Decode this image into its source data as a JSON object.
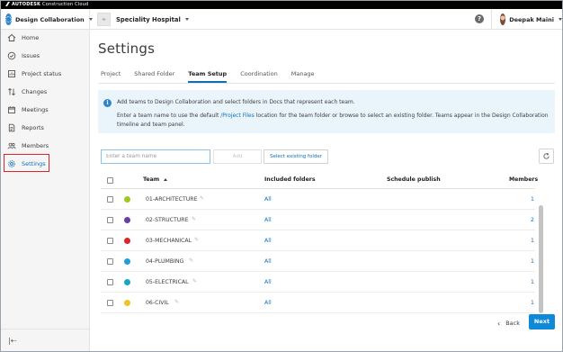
{
  "brand": {
    "logo_text": "AUTODESK",
    "product_text": "Construction Cloud"
  },
  "header": {
    "module_name": "Design Collaboration",
    "project_name": "Speciality Hospital",
    "help_label": "?",
    "user_name": "Deepak Maini"
  },
  "sidebar": {
    "items": [
      {
        "label": "Home",
        "icon": "home-icon"
      },
      {
        "label": "Issues",
        "icon": "issues-icon"
      },
      {
        "label": "Project status",
        "icon": "project-status-icon"
      },
      {
        "label": "Changes",
        "icon": "changes-icon"
      },
      {
        "label": "Meetings",
        "icon": "meetings-icon"
      },
      {
        "label": "Reports",
        "icon": "reports-icon"
      },
      {
        "label": "Members",
        "icon": "members-icon"
      },
      {
        "label": "Settings",
        "icon": "gear-icon"
      }
    ],
    "active": "Settings",
    "collapse_icon": "collapse-sidebar-icon"
  },
  "main": {
    "title": "Settings",
    "tabs": [
      {
        "label": "Project"
      },
      {
        "label": "Shared Folder"
      },
      {
        "label": "Team Setup"
      },
      {
        "label": "Coordination"
      },
      {
        "label": "Manage"
      }
    ],
    "active_tab": "Team Setup",
    "info": {
      "line1": "Add teams to Design Collaboration and select folders in Docs that represent each team.",
      "line2_before": "Enter a team name to use the default ",
      "line2_link": "/Project Files",
      "line2_after": " location for the team folder or browse to select an existing folder. Teams appear in the Design Collaboration",
      "line3": "timeline and team panel."
    },
    "team_input_placeholder": "Enter a team name",
    "add_label": "Add",
    "select_folder_label": "Select existing folder",
    "table": {
      "headers": {
        "team": "Team",
        "folders": "Included folders",
        "schedule": "Schedule publish",
        "members": "Members"
      },
      "rows": [
        {
          "name": "01-ARCHITECTURE",
          "color": "#a0c81e",
          "folders": "All",
          "members": "1"
        },
        {
          "name": "02-STRUCTURE",
          "color": "#6a3ea8",
          "folders": "All",
          "members": "2"
        },
        {
          "name": "03-MECHANICAL",
          "color": "#d9272e",
          "folders": "All",
          "members": "1"
        },
        {
          "name": "04-PLUMBING",
          "color": "#1e9fd9",
          "folders": "All",
          "members": "1"
        },
        {
          "name": "05-ELECTRICAL",
          "color": "#16a6c4",
          "folders": "All",
          "members": "1"
        },
        {
          "name": "06-CIVIL",
          "color": "#f0c324",
          "folders": "All",
          "members": "1"
        }
      ]
    },
    "back_label": "Back",
    "next_label": "Next"
  },
  "colors": {
    "accent": "#0f70b7",
    "primary_button": "#0f8ad6",
    "highlight_box": "#e0242c",
    "info_bg": "#eaf4fb"
  }
}
